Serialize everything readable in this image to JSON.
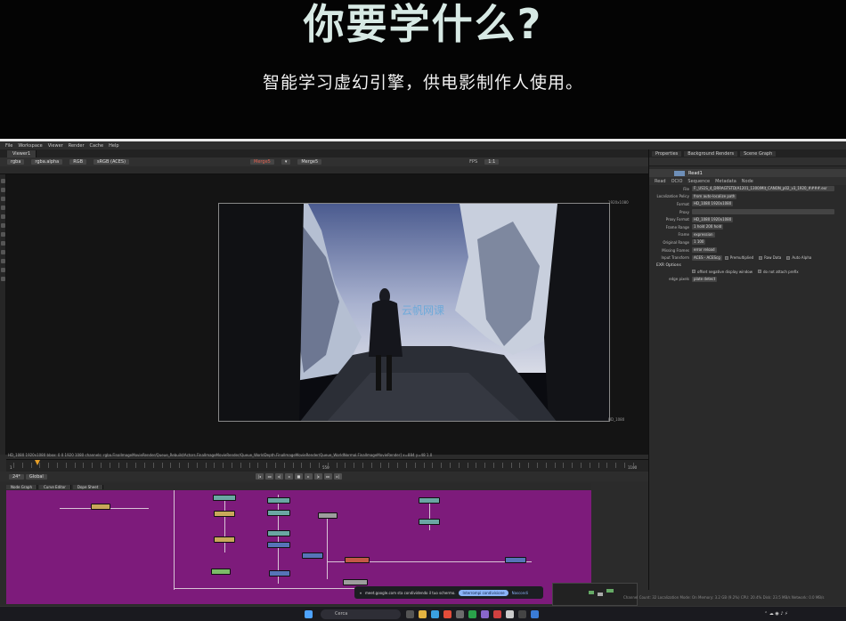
{
  "hero": {
    "title": "你要学什么?",
    "subtitle": "智能学习虚幻引擎，供电影制作人使用。"
  },
  "menubar": [
    "File",
    "Workspace",
    "Viewer",
    "Render",
    "Cache",
    "Help"
  ],
  "viewer": {
    "tab": "Viewer1",
    "toolbar": {
      "layer": "rgba",
      "channel": "rgba.alpha",
      "colorspace": "RGB",
      "lut": "sRGB (ACES)",
      "merge_a": "Merge5",
      "merge_b": "Merge5",
      "fps_label": "FPS",
      "zoom": "1:1"
    },
    "frame_label_top": "1920x1080",
    "frame_label_bottom": "HD_1080",
    "info_line": "HD_1080 1920x1080  bbox: 0 0 1920 1080 channels: rgba.FinalImageMovieRender/Queue_Rebuild/Actors.FinalImageMovieRender/Queue_WorldDepth.FinalImageMovieRender/Queue_WorldNormal.FinalImageMovieRender]  x=884 y=48 1.0"
  },
  "timeline": {
    "start": "1",
    "end": "1100",
    "mid_label": "550",
    "fps": "24*",
    "mode": "Global"
  },
  "nodegraph": {
    "tabs": [
      "Node Graph",
      "Curve Editor",
      "Dope Sheet"
    ]
  },
  "properties": {
    "tabs": [
      "Properties",
      "Background Renders",
      "Scene Graph"
    ],
    "node_name": "Read1",
    "subtabs": [
      "Read",
      "OCIO",
      "Sequence",
      "Metadata",
      "Node"
    ],
    "rows": [
      {
        "label": "File",
        "value": "F:_US1S_4_DRRAGTSTD(A1201_1300/Mit_CANON_p02_v3_1920_####.exr"
      },
      {
        "label": "Localization Policy",
        "value": "from auto-localize path"
      },
      {
        "label": "Format",
        "value": "HD_1080 1920x1080"
      },
      {
        "label": "Proxy",
        "value": ""
      },
      {
        "label": "Proxy Format",
        "value": "HD_1080 1920x1080"
      },
      {
        "label": "Frame Range",
        "value": "1  hold  200  hold"
      },
      {
        "label": "Frame",
        "value": "expression"
      },
      {
        "label": "Original Range",
        "value": "1  100"
      },
      {
        "label": "Missing Frames",
        "value": "error  reload"
      },
      {
        "label": "Input Transform",
        "value": "ACES - ACEScg"
      }
    ],
    "input_transform_checks": [
      "Premultiplied",
      "Raw Data",
      "Auto Alpha"
    ],
    "exr_header": "EXR Options",
    "exr_checks": [
      "offset negative display window",
      "do not attach prefix"
    ],
    "edge_pixels_label": "edge pixels",
    "edge_pixels_value": "plate detect"
  },
  "status_line": "Channel Count: 32  Localization Mode: On  Memory: 3.2 GB (9.2%)  CPU: 20.4%  Disk: 23.5 MB/s  Network: 0.0 MB/s",
  "toast": {
    "text": "meet.google.com sta condividendo il tuo schermo.",
    "share_button": "Interrompi condivisione",
    "hide_button": "Nascondi"
  },
  "taskbar": {
    "search_placeholder": "Cerca"
  },
  "colors": {
    "nodegraph_bg": "#7d1b7b",
    "title_color": "#d7e9e4",
    "accent_playhead": "#e8a028"
  }
}
